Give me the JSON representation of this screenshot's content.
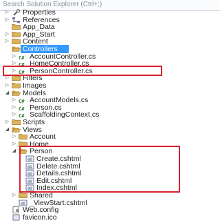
{
  "search": {
    "placeholder": "Search Solution Explorer (Ctrl+;)"
  },
  "colors": {
    "selection": "#3399ff",
    "highlight_box": "#d9232e",
    "folder": "#dcb35c",
    "cs_icon": "#2a7a2a"
  },
  "tree": [
    {
      "label": "Properties",
      "icon": "wrench-icon",
      "expand": "collapsed",
      "selected": false
    },
    {
      "label": "References",
      "icon": "references-icon",
      "expand": "collapsed",
      "selected": false
    },
    {
      "label": "App_Data",
      "icon": "folder-icon",
      "expand": "none",
      "selected": false
    },
    {
      "label": "App_Start",
      "icon": "folder-icon",
      "expand": "collapsed",
      "selected": false
    },
    {
      "label": "Content",
      "icon": "folder-icon",
      "expand": "collapsed",
      "selected": false
    },
    {
      "label": "Controllers",
      "icon": "folder-open-icon",
      "expand": "expanded",
      "selected": true
    },
    {
      "label": "AccountController.cs",
      "icon": "cs-file-icon",
      "expand": "collapsed",
      "selected": false
    },
    {
      "label": "HomeController.cs",
      "icon": "cs-file-icon",
      "expand": "collapsed",
      "selected": false
    },
    {
      "label": "PersonController.cs",
      "icon": "cs-file-icon",
      "expand": "collapsed",
      "selected": false
    },
    {
      "label": "Filters",
      "icon": "folder-icon",
      "expand": "collapsed",
      "selected": false
    },
    {
      "label": "Images",
      "icon": "folder-icon",
      "expand": "collapsed",
      "selected": false
    },
    {
      "label": "Models",
      "icon": "folder-open-icon",
      "expand": "expanded",
      "selected": false
    },
    {
      "label": "AccountModels.cs",
      "icon": "cs-file-icon",
      "expand": "collapsed",
      "selected": false
    },
    {
      "label": "Person.cs",
      "icon": "cs-file-icon",
      "expand": "collapsed",
      "selected": false
    },
    {
      "label": "ScaffoldingContext.cs",
      "icon": "cs-file-icon",
      "expand": "collapsed",
      "selected": false
    },
    {
      "label": "Scripts",
      "icon": "folder-icon",
      "expand": "collapsed",
      "selected": false
    },
    {
      "label": "Views",
      "icon": "folder-open-icon",
      "expand": "expanded",
      "selected": false
    },
    {
      "label": "Account",
      "icon": "folder-icon",
      "expand": "collapsed",
      "selected": false
    },
    {
      "label": "Home",
      "icon": "folder-icon",
      "expand": "collapsed",
      "selected": false
    },
    {
      "label": "Person",
      "icon": "folder-open-icon",
      "expand": "expanded",
      "selected": false
    },
    {
      "label": "Create.cshtml",
      "icon": "cshtml-file-icon",
      "expand": "none",
      "selected": false
    },
    {
      "label": "Delete.cshtml",
      "icon": "cshtml-file-icon",
      "expand": "none",
      "selected": false
    },
    {
      "label": "Details.cshtml",
      "icon": "cshtml-file-icon",
      "expand": "none",
      "selected": false
    },
    {
      "label": "Edit.cshtml",
      "icon": "cshtml-file-icon",
      "expand": "none",
      "selected": false
    },
    {
      "label": "Index.cshtml",
      "icon": "cshtml-file-icon",
      "expand": "none",
      "selected": false
    },
    {
      "label": "Shared",
      "icon": "folder-icon",
      "expand": "collapsed",
      "selected": false
    },
    {
      "label": "_ViewStart.cshtml",
      "icon": "cshtml-file-icon",
      "expand": "none",
      "selected": false
    },
    {
      "label": "Web.config",
      "icon": "config-file-icon",
      "expand": "none",
      "selected": false
    },
    {
      "label": "favicon.ico",
      "icon": "image-file-icon",
      "expand": "none",
      "selected": false
    }
  ]
}
